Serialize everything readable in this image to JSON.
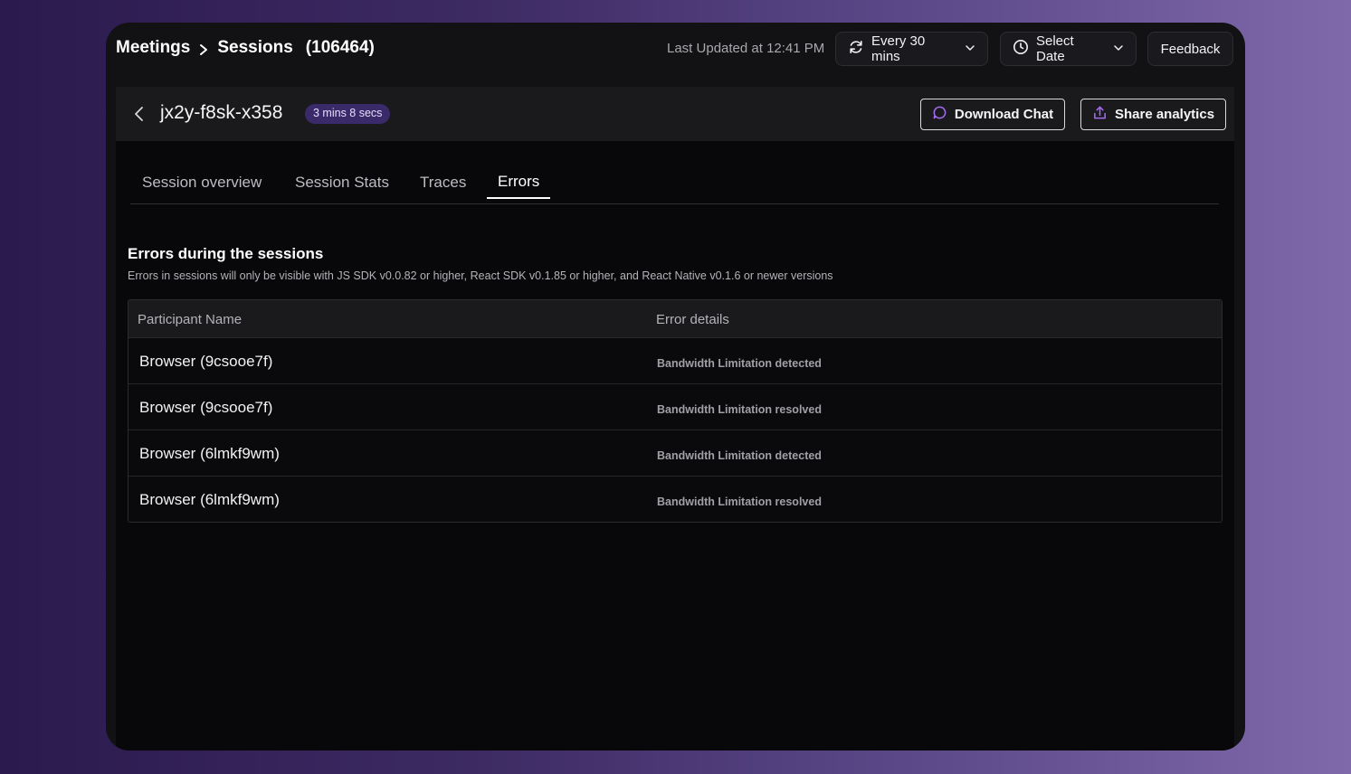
{
  "header": {
    "breadcrumb": {
      "meetings": "Meetings",
      "sessions": "Sessions",
      "count": "(106464)"
    },
    "last_updated": "Last Updated at 12:41 PM",
    "refresh_label": "Every 30 mins",
    "date_label": "Select Date",
    "feedback_label": "Feedback"
  },
  "session": {
    "id": "jx2y-f8sk-x358",
    "duration": "3 mins 8 secs",
    "download_label": "Download Chat",
    "share_label": "Share analytics"
  },
  "tabs": [
    {
      "label": "Session overview"
    },
    {
      "label": "Session Stats"
    },
    {
      "label": "Traces"
    },
    {
      "label": "Errors"
    }
  ],
  "active_tab": "Errors",
  "errors": {
    "title": "Errors during the sessions",
    "subtitle": "Errors in sessions will only be visible with JS SDK v0.0.82 or higher, React SDK v0.1.85 or higher, and React Native v0.1.6 or newer versions",
    "columns": {
      "name": "Participant Name",
      "details": "Error details"
    },
    "rows": [
      {
        "name": "Browser (9csooe7f)",
        "detail": "Bandwidth Limitation detected"
      },
      {
        "name": "Browser (9csooe7f)",
        "detail": "Bandwidth Limitation resolved"
      },
      {
        "name": "Browser (6lmkf9wm)",
        "detail": "Bandwidth Limitation detected"
      },
      {
        "name": "Browser (6lmkf9wm)",
        "detail": "Bandwidth Limitation resolved"
      }
    ]
  },
  "colors": {
    "accent": "#8b5cf6",
    "badge_bg": "#3a2a6a",
    "panel_bg": "#08080a"
  }
}
